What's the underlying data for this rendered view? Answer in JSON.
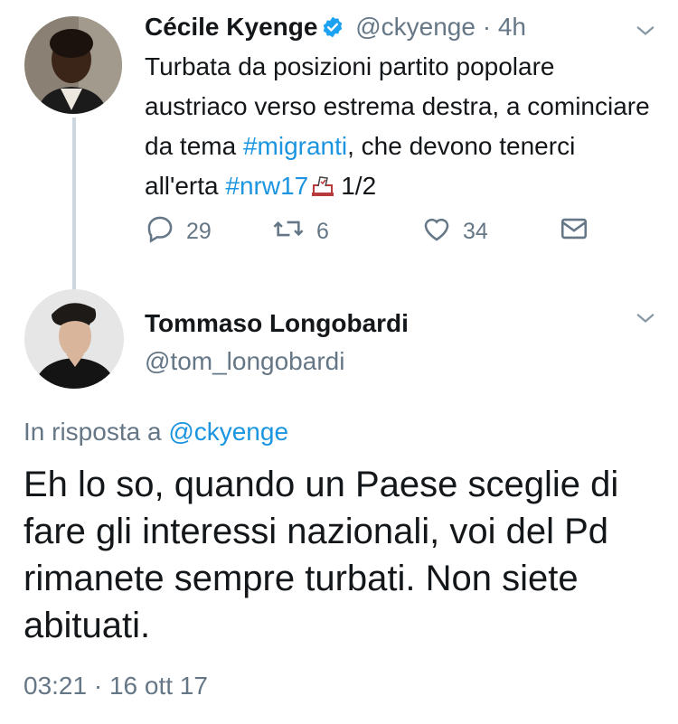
{
  "tweet1": {
    "author_name": "Cécile Kyenge",
    "handle": "@ckyenge",
    "separator": "·",
    "time": "4h",
    "text_parts": {
      "p1": "Turbata da posizioni partito popolare austriaco verso estrema destra, a cominciare da tema ",
      "hashtag1": "#migranti",
      "p2": ", che devono tenerci all'erta ",
      "hashtag2": "#nrw17",
      "p3": "1/2"
    },
    "actions": {
      "replies": "29",
      "retweets": "6",
      "likes": "34"
    }
  },
  "tweet2": {
    "author_name": "Tommaso Longobardi",
    "handle": "@tom_longobardi",
    "reply_prefix": "In risposta a",
    "reply_mention": "@ckyenge",
    "text": "Eh lo so, quando un Paese sceglie di fare gli interessi nazionali, voi del Pd rimanete sempre turbati. Non siete abituati.",
    "timestamp": "03:21 · 16 ott 17"
  },
  "colors": {
    "link": "#1b95e0",
    "secondary": "#657786",
    "thread_line": "#ccd6dd",
    "verified": "#1da1f2"
  },
  "icons": [
    "verified-icon",
    "chevron-down-icon",
    "reply-icon",
    "retweet-icon",
    "like-icon",
    "direct-message-icon",
    "ballot-box-emoji"
  ]
}
